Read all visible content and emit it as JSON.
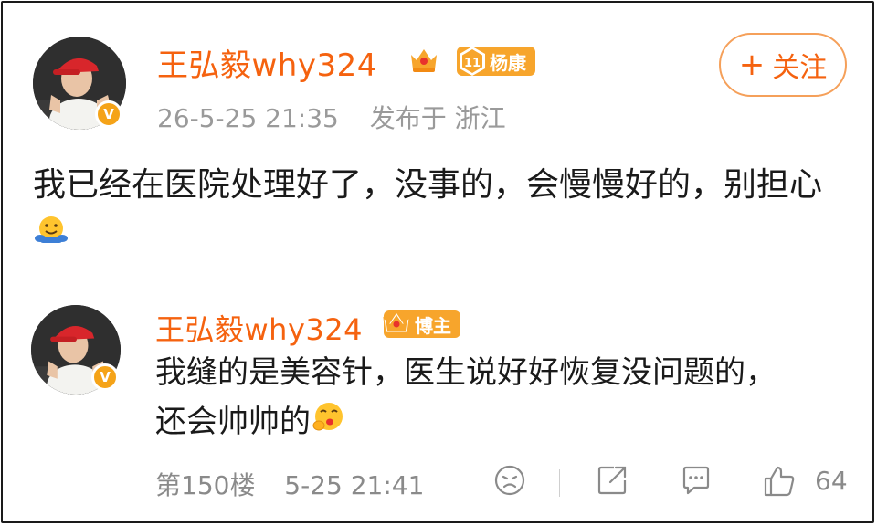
{
  "colors": {
    "username": "#f5620f",
    "badge": "#f7a52c",
    "verified": "#f5a318",
    "meta": "#9a9a9a"
  },
  "post": {
    "username": "王弘毅why324",
    "fan_badge": {
      "level": "11",
      "label": "杨康"
    },
    "timestamp": "26-5-25 21:35",
    "location": "发布于 浙江",
    "follow_label": "关注",
    "text_before_emoji": "我已经在医院处理好了，没事的，会慢慢好的，别担心",
    "emoji": "hug-emoji"
  },
  "reply": {
    "username": "王弘毅why324",
    "tag": "博主",
    "line1": "我缝的是美容针，医生说好好恢复没问题的，",
    "line2": "还会帅帅的",
    "emoji": "kiss-emoji",
    "floor": "第150楼",
    "timestamp": "5-25 21:41",
    "like_count": "64",
    "icons": [
      "dislike-icon",
      "share-icon",
      "comment-icon",
      "like-icon"
    ]
  }
}
